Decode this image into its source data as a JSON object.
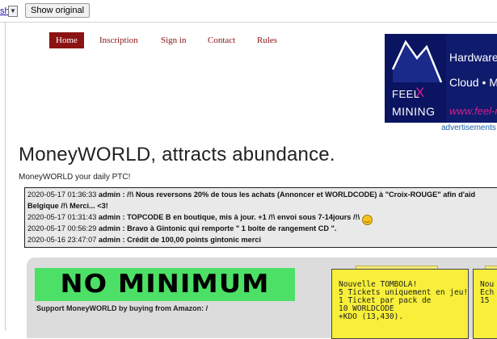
{
  "translate_bar": {
    "language_link": "sh",
    "show_original_label": "Show original"
  },
  "nav": {
    "items": [
      "Home",
      "Inscription",
      "Sign in",
      "Contact",
      "Rules"
    ]
  },
  "ad": {
    "brand_word1": "FEEL",
    "brand_x": "X",
    "brand_word2": "MINING",
    "line1": "Hardware •",
    "line2": "Cloud • Mas",
    "line3": "www.feel-m",
    "label": "advertisements"
  },
  "page": {
    "title": "MoneyWORLD, attracts abundance.",
    "subtitle": "MoneyWORLD your daily PTC!"
  },
  "news": [
    {
      "timestamp": "2020-05-17 01:36:33",
      "author": "admin",
      "message": " : /!\\ Nous reversons 20% de tous les achats (Annoncer et WORLDCODE) à \"Croix-ROUGE\" afin d'aid"
    },
    {
      "timestamp": "",
      "author": "",
      "message": "Belgique /!\\ Merci... <3!"
    },
    {
      "timestamp": "2020-05-17 01:31:43",
      "author": "admin",
      "message": " : TOPCODE B en boutique, mis à jour. +1 /!\\ envoi sous 7-14jours /!\\"
    },
    {
      "timestamp": "2020-05-17 00:56:29",
      "author": "admin",
      "message": " : Bravo à Gintonic qui remporte \" 1 boite de rangement CD \"."
    },
    {
      "timestamp": "2020-05-16 23:47:07",
      "author": "admin",
      "message": " : Crédit de 100,00 points gintonic merci"
    }
  ],
  "promo": {
    "banner_text": "NO MINIMUM",
    "support_text": "Support MoneyWORLD by buying from Amazon: /"
  },
  "note1": {
    "text": "Nouvelle TOMBOLA!\n5 Tickets uniquement en jeu!\n1 Ticket par pack de\n10 WORLDCODE\n+KDO (13,430)."
  },
  "note2": {
    "text": "Nou\nEch\n15"
  },
  "colors": {
    "nav_active_bg": "#8b1212",
    "nav_link": "#8b1010",
    "banner_green": "#4ce066",
    "note_yellow": "#f7ef3a",
    "ad_navy": "#0f1b6d",
    "ad_magenta": "#d61e8a"
  }
}
